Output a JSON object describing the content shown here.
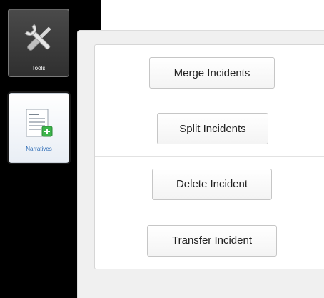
{
  "sidebar": {
    "items": [
      {
        "label": "Tools",
        "icon": "tools-icon",
        "active": true
      },
      {
        "label": "Narratives",
        "icon": "narratives-icon",
        "active": false
      }
    ]
  },
  "actions": [
    {
      "label": "Merge Incidents"
    },
    {
      "label": "Split Incidents"
    },
    {
      "label": "Delete Incident"
    },
    {
      "label": "Transfer Incident"
    }
  ],
  "colors": {
    "rail": "#000000",
    "narratives_label": "#2a6ab5",
    "narratives_badge": "#3cb44a"
  }
}
